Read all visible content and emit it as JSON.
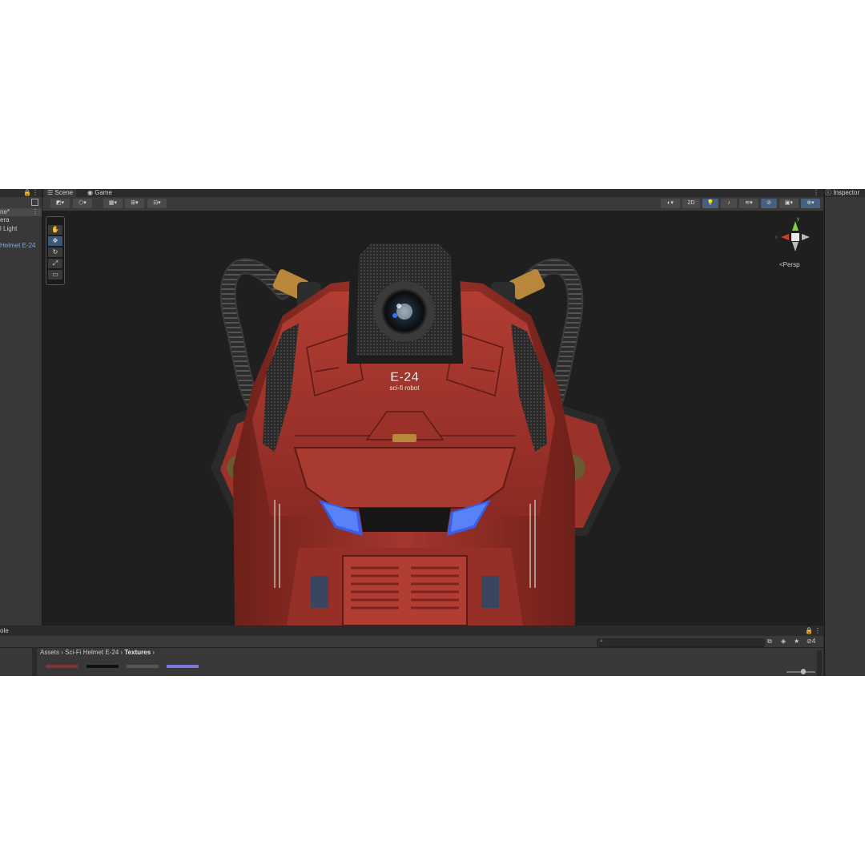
{
  "hierarchy": {
    "items": [
      {
        "label": "ne*",
        "selected": true
      },
      {
        "label": "era"
      },
      {
        "label": "l Light"
      },
      {
        "label": "Helmet E-24"
      }
    ]
  },
  "scene": {
    "tabs": [
      {
        "label": "Scene",
        "icon": "grid-icon"
      },
      {
        "label": "Game",
        "icon": "gamepad-icon"
      }
    ],
    "toolbar": {
      "mode_2d": "2D"
    },
    "tools": [
      "hand-icon",
      "move-icon",
      "rotate-icon",
      "scale-icon",
      "rect-icon",
      "transform-icon"
    ],
    "gizmo": {
      "y_label": "y",
      "x_label": "x",
      "projection": "Persp"
    },
    "model": {
      "primary_text": "E-24",
      "secondary_text": "sci-fi robot",
      "colors": {
        "shell": "#a4362d",
        "glow": "#2f63ff"
      }
    }
  },
  "inspector": {
    "title": "Inspector"
  },
  "project": {
    "tab_label": "ole",
    "breadcrumb": [
      "Assets",
      "Sci-Fi Helmet E-24",
      "Textures"
    ],
    "hidden_count": "4"
  },
  "colors": {
    "panel_bg": "#383838",
    "viewport_bg": "#1f1f1f",
    "selection": "#46607f",
    "accent_link": "#7fa8e0"
  }
}
